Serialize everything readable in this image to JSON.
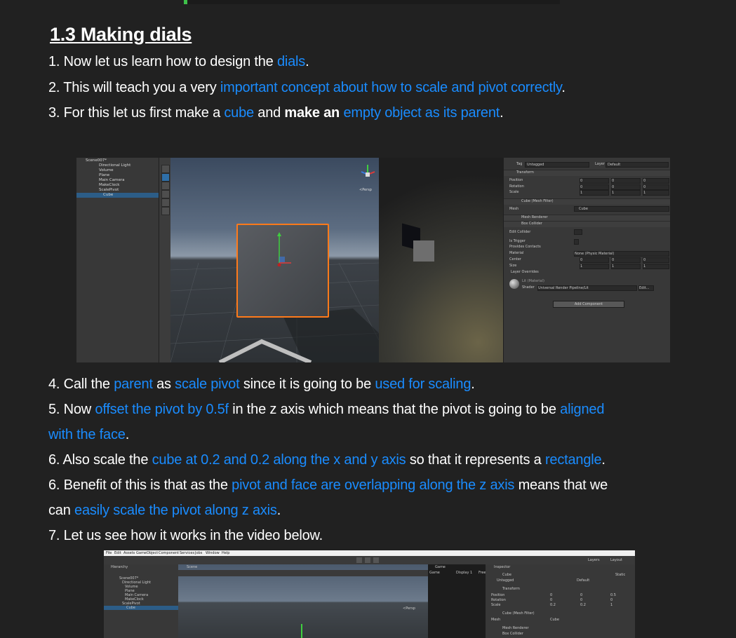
{
  "section_title": "1.3 Making dials",
  "lines": [
    {
      "id": "l1",
      "segments": [
        {
          "t": "1. Now let us learn how to design the "
        },
        {
          "t": "dials",
          "hl": true
        },
        {
          "t": "."
        }
      ]
    },
    {
      "id": "l2",
      "segments": [
        {
          "t": "2. This will teach you a very "
        },
        {
          "t": "important concept about how to scale and pivot correctly",
          "hl": true
        },
        {
          "t": "."
        }
      ]
    },
    {
      "id": "l3",
      "segments": [
        {
          "t": "3. For this let us first make a "
        },
        {
          "t": "cube",
          "hl": true
        },
        {
          "t": " and "
        },
        {
          "t": "make an",
          "bold": true
        },
        {
          "t": " "
        },
        {
          "t": "empty object as its parent",
          "hl": true
        },
        {
          "t": "."
        }
      ]
    },
    {
      "id": "l4",
      "segments": [
        {
          "t": "4. Call the "
        },
        {
          "t": "parent",
          "hl": true
        },
        {
          "t": " as "
        },
        {
          "t": "scale pivot",
          "hl": true
        },
        {
          "t": " since it is going to be "
        },
        {
          "t": "used for scaling",
          "hl": true
        },
        {
          "t": "."
        }
      ]
    },
    {
      "id": "l5",
      "segments": [
        {
          "t": "5. Now "
        },
        {
          "t": "offset the pivot by 0.5f",
          "hl": true
        },
        {
          "t": " in the z axis which means that the pivot is going to be "
        },
        {
          "t": "aligned",
          "hl": true
        }
      ]
    },
    {
      "id": "l5b",
      "segments": [
        {
          "t": "with the face",
          "hl": true
        },
        {
          "t": "."
        }
      ]
    },
    {
      "id": "l6",
      "segments": [
        {
          "t": "6. Also scale the "
        },
        {
          "t": "cube at 0.2 and 0.2 along the x and y axis",
          "hl": true
        },
        {
          "t": " so that it represents a "
        },
        {
          "t": "rectangle",
          "hl": true
        },
        {
          "t": "."
        }
      ]
    },
    {
      "id": "l7",
      "segments": [
        {
          "t": "6. Benefit of this is that as the "
        },
        {
          "t": "pivot and face are overlapping along the z axis",
          "hl": true
        },
        {
          "t": " means that we"
        }
      ]
    },
    {
      "id": "l7b",
      "segments": [
        {
          "t": "can "
        },
        {
          "t": "easily scale the pivot along z axis",
          "hl": true
        },
        {
          "t": "."
        }
      ]
    },
    {
      "id": "l8",
      "segments": [
        {
          "t": "7. Let us see how it works in the video below."
        }
      ]
    }
  ],
  "shot1": {
    "hierarchy": [
      "Scene007*",
      "Directional Light",
      "Volume",
      "Plane",
      "Main Camera",
      "MakeClock",
      "ScalePivot",
      "Cube"
    ],
    "persp_label": "<Persp",
    "inspector": {
      "tag_label": "Tag",
      "tag_value": "Untagged",
      "layer_label": "Layer",
      "layer_value": "Default",
      "transform": "Transform",
      "position": "Position",
      "rotation": "Rotation",
      "scale": "Scale",
      "pos": [
        "0",
        "0",
        "0"
      ],
      "rot": [
        "0",
        "0",
        "0"
      ],
      "scl": [
        "1",
        "1",
        "1"
      ],
      "axis_x": "X",
      "axis_y": "Y",
      "axis_z": "Z",
      "mesh_filter": "Cube (Mesh Filter)",
      "mesh_label": "Mesh",
      "mesh_value": "Cube",
      "mesh_renderer": "Mesh Renderer",
      "box_collider": "Box Collider",
      "edit_collider": "Edit Collider",
      "is_trigger": "Is Trigger",
      "provides_contacts": "Provides Contacts",
      "material_label": "Material",
      "material_value": "None (Physic Material)",
      "center_label": "Center",
      "size_label": "Size",
      "center": [
        "0",
        "0",
        "0"
      ],
      "size": [
        "1",
        "1",
        "1"
      ],
      "layer_overrides": "Layer Overrides",
      "lit_material": "Lit (Material)",
      "shader_label": "Shader",
      "shader_value": "Universal Render Pipeline/Lit",
      "edit_label": "Edit...",
      "add_component": "Add Component"
    }
  },
  "shot2": {
    "menu": [
      "File",
      "Edit",
      "Assets",
      "GameObject",
      "Component",
      "Services",
      "Jobs",
      "Window",
      "Help"
    ],
    "hierarchy_tab": "Hierarchy",
    "scene_tab": "Scene",
    "game_tab": "Game",
    "inspector_tab": "Inspector",
    "game_dd": "Game",
    "display_dd": "Display 1",
    "free_label": "Free",
    "layers": "Layers",
    "layout": "Layout",
    "hierarchy": [
      "Scene007*",
      "Directional Light",
      "Volume",
      "Plane",
      "Main Camera",
      "MakeClock",
      "ScalePivot",
      "Cube"
    ],
    "persp_label": "<Persp",
    "obj_name": "Cube",
    "static_label": "Static",
    "tag_value": "Untagged",
    "layer_value": "Default",
    "transform": "Transform",
    "position": "Position",
    "rotation": "Rotation",
    "scale": "Scale",
    "pos": [
      "0",
      "0",
      "0.5"
    ],
    "rot": [
      "0",
      "0",
      "0"
    ],
    "scl": [
      "0.2",
      "0.2",
      "1"
    ],
    "mesh_filter": "Cube (Mesh Filter)",
    "mesh_label": "Mesh",
    "mesh_value": "Cube",
    "mesh_renderer": "Mesh Renderer",
    "box_collider": "Box Collider"
  }
}
